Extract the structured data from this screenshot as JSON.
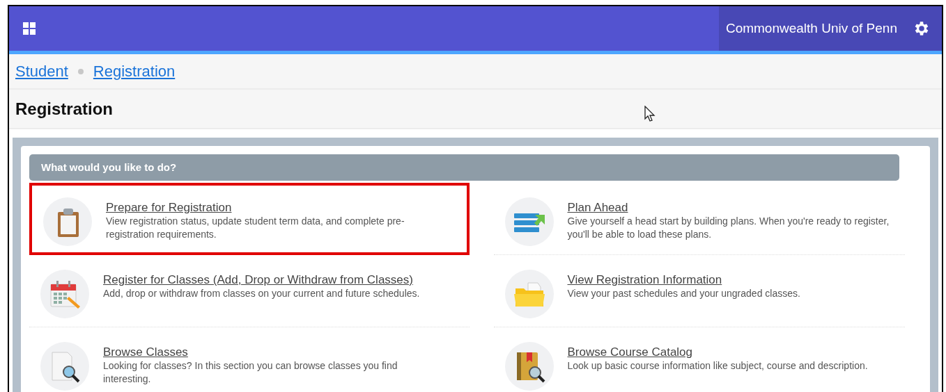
{
  "header": {
    "institution": "Commonwealth Univ of Penn"
  },
  "breadcrumbs": [
    {
      "label": "Student"
    },
    {
      "label": "Registration"
    }
  ],
  "page_title": "Registration",
  "panel": {
    "heading": "What would you like to do?",
    "items": [
      {
        "kind": "clipboard",
        "title": "Prepare for Registration",
        "description": "View registration status, update student term data, and complete pre-registration requirements.",
        "highlighted": true
      },
      {
        "kind": "plan",
        "title": "Plan Ahead",
        "description": "Give yourself a head start by building plans. When you're ready to register, you'll be able to load these plans.",
        "highlighted": false
      },
      {
        "kind": "calendar",
        "title": "Register for Classes (Add, Drop or Withdraw from Classes)",
        "description": "Add, drop or withdraw from classes on your current and future schedules.",
        "highlighted": false
      },
      {
        "kind": "folder",
        "title": "View Registration Information",
        "description": "View your past schedules and your ungraded classes.",
        "highlighted": false
      },
      {
        "kind": "document",
        "title": "Browse Classes",
        "description": "Looking for classes? In this section you can browse classes you find interesting.",
        "highlighted": false
      },
      {
        "kind": "book",
        "title": "Browse Course Catalog",
        "description": "Look up basic course information like subject, course and description.",
        "highlighted": false
      }
    ]
  }
}
